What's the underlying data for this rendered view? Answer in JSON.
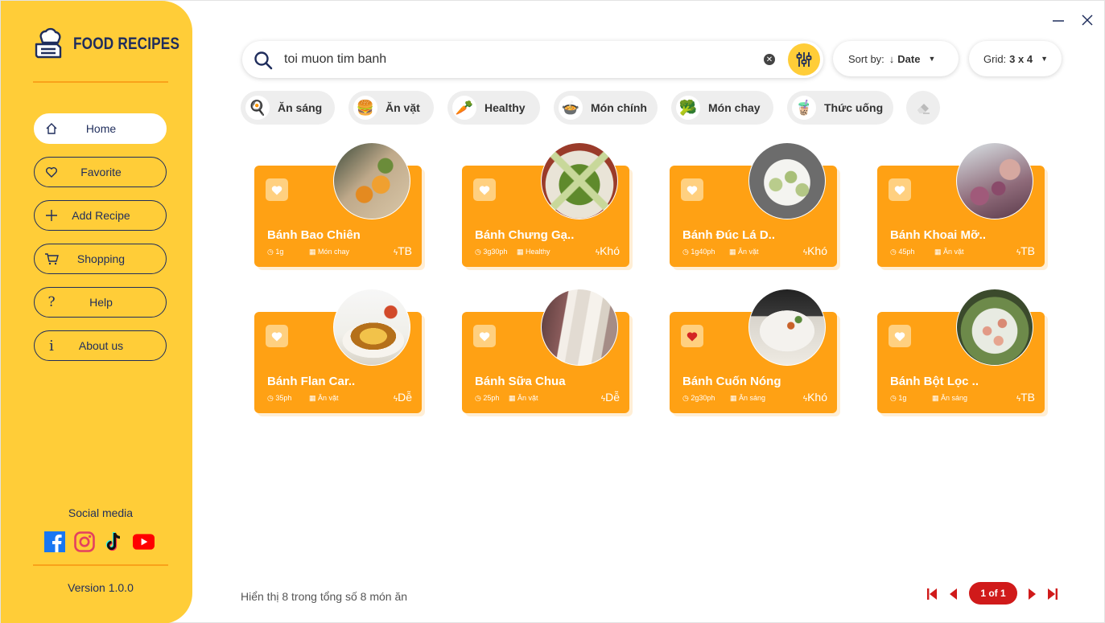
{
  "app": {
    "title": "FOOD RECIPES",
    "accent_color": "#FFCD38",
    "card_color": "#FFA114",
    "text_color": "#1f2d5c"
  },
  "window_controls": {
    "minimize_icon": "minus-icon",
    "close_icon": "close-icon"
  },
  "sidebar": {
    "items": [
      {
        "label": "Home",
        "icon": "home-icon",
        "active": true
      },
      {
        "label": "Favorite",
        "icon": "heart-icon",
        "active": false
      },
      {
        "label": "Add Recipe",
        "icon": "plus-icon",
        "active": false
      },
      {
        "label": "Shopping",
        "icon": "cart-icon",
        "active": false
      },
      {
        "label": "Help",
        "icon": "question-icon",
        "active": false
      },
      {
        "label": "About us",
        "icon": "info-icon",
        "active": false
      }
    ],
    "social_title": "Social media",
    "socials": [
      "facebook-icon",
      "instagram-icon",
      "tiktok-icon",
      "youtube-icon"
    ],
    "version": "Version 1.0.0"
  },
  "search": {
    "value": "toi muon tim banh",
    "placeholder": ""
  },
  "sort": {
    "label": "Sort by:",
    "arrow": "↓",
    "value": "Date"
  },
  "grid": {
    "label": "Grid:",
    "value": "3 x 4"
  },
  "categories": [
    {
      "label": "Ăn sáng",
      "icon": "breakfast-icon"
    },
    {
      "label": "Ăn vặt",
      "icon": "snack-icon"
    },
    {
      "label": "Healthy",
      "icon": "vegetables-icon"
    },
    {
      "label": "Món chính",
      "icon": "main-dish-icon"
    },
    {
      "label": "Món chay",
      "icon": "broccoli-icon"
    },
    {
      "label": "Thức uống",
      "icon": "drink-icon"
    },
    {
      "label": "",
      "icon": "eraser-icon"
    }
  ],
  "recipes": [
    {
      "title": "Bánh Bao Chiên",
      "time": "1g",
      "category": "Món chay",
      "difficulty": "TB",
      "favorite": false
    },
    {
      "title": "Bánh Chưng Gạ..",
      "time": "3g30ph",
      "category": "Healthy",
      "difficulty": "Khó",
      "favorite": false
    },
    {
      "title": "Bánh Đúc Lá D..",
      "time": "1g40ph",
      "category": "Ăn vặt",
      "difficulty": "Khó",
      "favorite": false
    },
    {
      "title": "Bánh Khoai Mỡ..",
      "time": "45ph",
      "category": "Ăn vặt",
      "difficulty": "TB",
      "favorite": false
    },
    {
      "title": "Bánh Flan Car..",
      "time": "35ph",
      "category": "Ăn vặt",
      "difficulty": "Dễ",
      "favorite": false
    },
    {
      "title": "Bánh Sữa Chua",
      "time": "25ph",
      "category": "Ăn vặt",
      "difficulty": "Dễ",
      "favorite": false
    },
    {
      "title": "Bánh Cuốn Nóng",
      "time": "2g30ph",
      "category": "Ăn sáng",
      "difficulty": "Khó",
      "favorite": true
    },
    {
      "title": "Bánh Bột Lọc ..",
      "time": "1g",
      "category": "Ăn sáng",
      "difficulty": "TB",
      "favorite": false
    }
  ],
  "footer": {
    "summary": "Hiển thị 8 trong tổng số 8 món ăn",
    "page_indicator": "1 of 1"
  }
}
